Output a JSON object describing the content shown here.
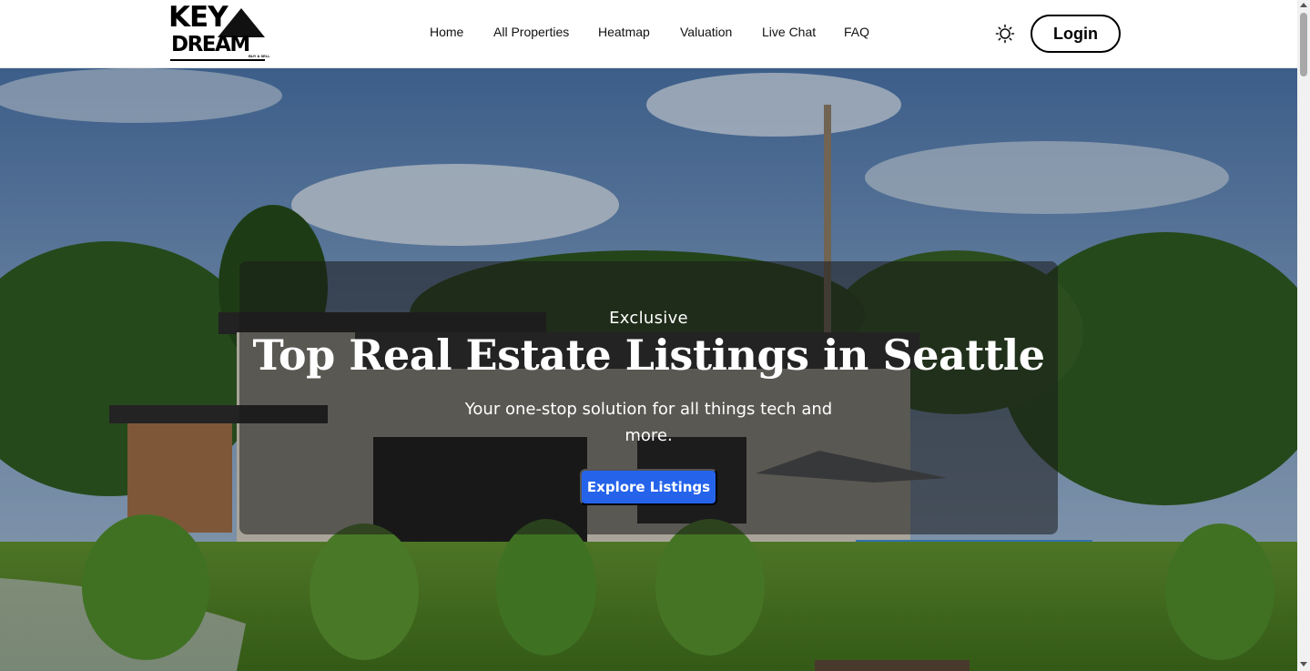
{
  "brand": {
    "logo_top": "KEY",
    "logo_bottom": "DREAM",
    "logo_tagline": "BUY & SELL"
  },
  "nav": {
    "items": [
      {
        "label": "Home"
      },
      {
        "label": "All Properties"
      },
      {
        "label": "Heatmap"
      },
      {
        "label": "Valuation"
      },
      {
        "label": "Live Chat"
      },
      {
        "label": "FAQ"
      }
    ],
    "theme_icon": "sun-icon",
    "login_label": "Login"
  },
  "hero": {
    "eyebrow": "Exclusive",
    "title": "Top Real Estate Listings in Seattle",
    "subtitle": "Your one-stop solution for all things tech and more.",
    "cta_label": "Explore Listings",
    "background": "modern-house-with-pool-render"
  },
  "colors": {
    "accent": "#2563eb",
    "nav_bg": "#ffffff",
    "text": "#111111"
  }
}
